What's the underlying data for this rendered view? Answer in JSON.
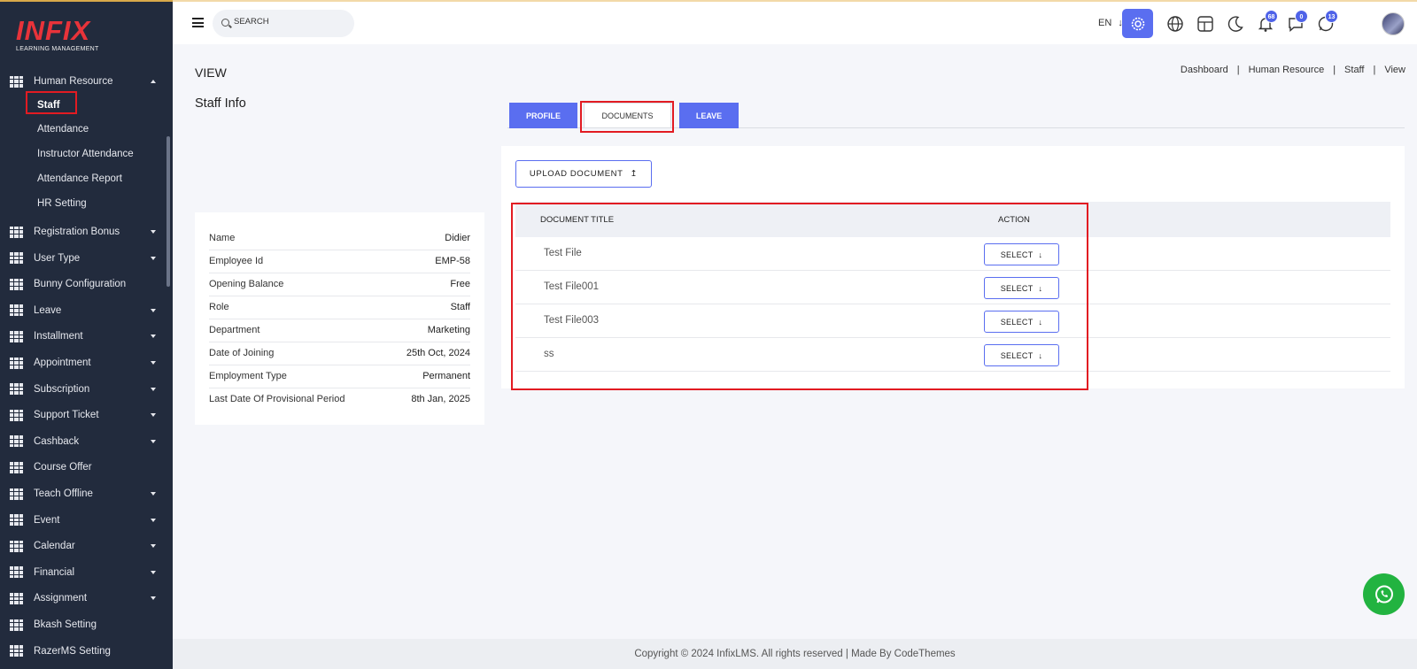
{
  "logo": {
    "brand": "INFIX",
    "tagline": "LEARNING MANAGEMENT"
  },
  "sidebar": {
    "parent": {
      "label": "Human Resource"
    },
    "sub_items": [
      {
        "label": "Staff"
      },
      {
        "label": "Attendance"
      },
      {
        "label": "Instructor Attendance"
      },
      {
        "label": "Attendance Report"
      },
      {
        "label": "HR Setting"
      }
    ],
    "items": [
      {
        "label": "Registration Bonus",
        "caret": true
      },
      {
        "label": "User Type",
        "caret": true
      },
      {
        "label": "Bunny Configuration",
        "caret": false
      },
      {
        "label": "Leave",
        "caret": true
      },
      {
        "label": "Installment",
        "caret": true
      },
      {
        "label": "Appointment",
        "caret": true
      },
      {
        "label": "Subscription",
        "caret": true
      },
      {
        "label": "Support Ticket",
        "caret": true
      },
      {
        "label": "Cashback",
        "caret": true
      },
      {
        "label": "Course Offer",
        "caret": false
      },
      {
        "label": "Teach Offline",
        "caret": true
      },
      {
        "label": "Event",
        "caret": true
      },
      {
        "label": "Calendar",
        "caret": true
      },
      {
        "label": "Financial",
        "caret": true
      },
      {
        "label": "Assignment",
        "caret": true
      },
      {
        "label": "Bkash Setting",
        "caret": false
      },
      {
        "label": "RazerMS Setting",
        "caret": false
      }
    ]
  },
  "topbar": {
    "search_placeholder": "SEARCH",
    "language": "EN",
    "badges": {
      "notifications": "68",
      "messages": "0",
      "chat": "13"
    }
  },
  "page": {
    "title": "VIEW",
    "breadcrumb": [
      "Dashboard",
      "Human Resource",
      "Staff",
      "View"
    ],
    "staff_info_title": "Staff Info"
  },
  "staff_info": [
    {
      "key": "Name",
      "value": "Didier"
    },
    {
      "key": "Employee Id",
      "value": "EMP-58"
    },
    {
      "key": "Opening Balance",
      "value": "Free"
    },
    {
      "key": "Role",
      "value": "Staff"
    },
    {
      "key": "Department",
      "value": "Marketing"
    },
    {
      "key": "Date of Joining",
      "value": "25th Oct, 2024"
    },
    {
      "key": "Employment Type",
      "value": "Permanent"
    },
    {
      "key": "Last Date Of Provisional Period",
      "value": "8th Jan, 2025"
    }
  ],
  "tabs": [
    {
      "label": "PROFILE",
      "active": false
    },
    {
      "label": "DOCUMENTS",
      "active": true
    },
    {
      "label": "LEAVE",
      "active": false
    }
  ],
  "documents": {
    "upload_label": "UPLOAD DOCUMENT",
    "columns": [
      "DOCUMENT TITLE",
      "ACTION"
    ],
    "rows": [
      {
        "title": "Test File",
        "action": "SELECT"
      },
      {
        "title": "Test File001",
        "action": "SELECT"
      },
      {
        "title": "Test File003",
        "action": "SELECT"
      },
      {
        "title": "ss",
        "action": "SELECT"
      }
    ]
  },
  "footer": {
    "text": "Copyright © 2024 InfixLMS. All rights reserved | Made By CodeThemes"
  },
  "colors": {
    "accent": "#5a6ef0",
    "sidebar": "#222b3d",
    "highlight": "#e21b22",
    "whatsapp": "#22b340"
  }
}
